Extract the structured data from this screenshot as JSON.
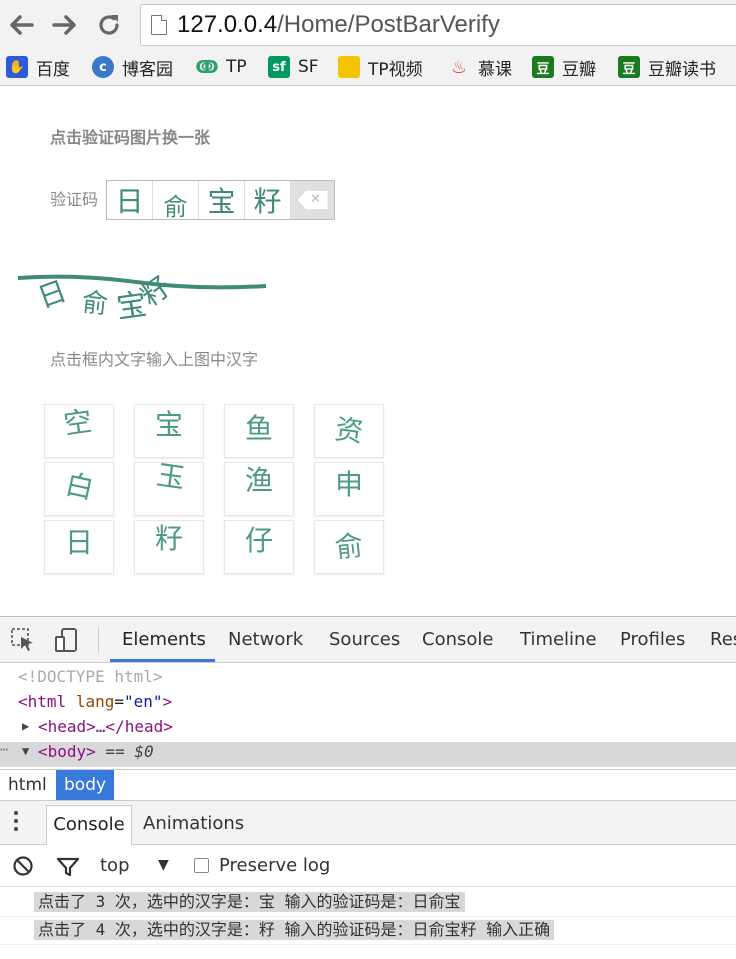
{
  "browser": {
    "url_host": "127.0.0.4",
    "url_path": "/Home/PostBarVerify",
    "back_icon": "arrow-left-icon",
    "forward_icon": "arrow-right-icon",
    "reload_icon": "reload-icon",
    "bookmarks": [
      {
        "label": "百度",
        "color": "#2d5ad8",
        "glyph": "🐾"
      },
      {
        "label": "博客园",
        "color": "#3b78c9",
        "glyph": "c"
      },
      {
        "label": "TP",
        "color": "#2aa16b",
        "glyph": "~"
      },
      {
        "label": "SF",
        "color": "#009a61",
        "glyph": "sf"
      },
      {
        "label": "TP视频",
        "color": "#f5c400",
        "glyph": ""
      },
      {
        "label": "慕课",
        "color": "#e8442b",
        "glyph": "🔥"
      },
      {
        "label": "豆瓣",
        "color": "#1a7a1e",
        "glyph": "豆"
      },
      {
        "label": "豆瓣读书",
        "color": "#1a7a1e",
        "glyph": "豆"
      }
    ]
  },
  "page": {
    "hint_top": "点击验证码图片换一张",
    "captcha_label": "验证码",
    "captcha_chars": [
      "日",
      "俞",
      "宝",
      "籽"
    ],
    "captcha_image_text": [
      "日",
      "俞",
      "宝",
      "籽"
    ],
    "hint_click": "点击框内文字输入上图中汉字",
    "grid": [
      [
        "空",
        "宝",
        "鱼",
        "资"
      ],
      [
        "白",
        "玉",
        "渔",
        "申"
      ],
      [
        "日",
        "籽",
        "仔",
        "俞"
      ]
    ]
  },
  "devtools": {
    "tabs": [
      "Elements",
      "Network",
      "Sources",
      "Console",
      "Timeline",
      "Profiles",
      "Res"
    ],
    "dom": {
      "doctype": "<!DOCTYPE html>",
      "html_tag": "html",
      "html_attr": "lang",
      "html_val": "\"en\"",
      "head": "<head>…</head>",
      "body": "<body>",
      "body_suffix": " == $0"
    },
    "crumbs": [
      "html",
      "body"
    ],
    "drawer_tabs": [
      "Console",
      "Animations"
    ],
    "filter_context": "top",
    "preserve_log": "Preserve log",
    "messages": [
      "点击了 3 次，选中的汉字是：宝 输入的验证码是：日俞宝",
      "点击了 4 次，选中的汉字是：籽 输入的验证码是：日俞宝籽 输入正确"
    ]
  }
}
